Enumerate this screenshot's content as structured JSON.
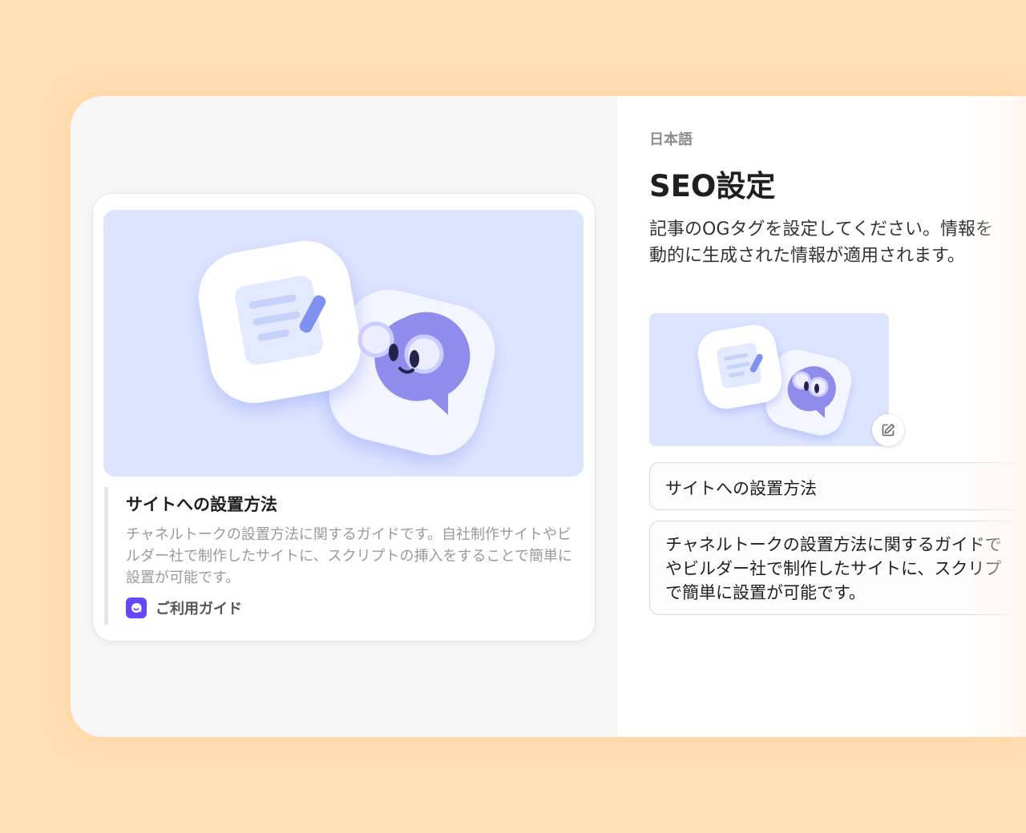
{
  "preview_card": {
    "title": "サイトへの設置方法",
    "description": "チャネルトークの設置方法に関するガイドです。自社制作サイトやビルダー社で制作したサイトに、スクリプトの挿入をすることで簡単に設置が可能です。",
    "source_label": "ご利用ガイド",
    "source_icon": "channel-talk-logo-icon",
    "image": "document-and-mascot-illustration"
  },
  "seo_panel": {
    "language": "日本語",
    "title": "SEO設定",
    "description_line1": "記事のOGタグを設定してください。情報を",
    "description_line2": "動的に生成された情報が適用されます。",
    "og_image": "document-and-mascot-illustration",
    "edit_icon": "edit-pencil-icon",
    "og_title_value": "サイトへの設置方法",
    "og_description_line1": "チャネルトークの設置方法に関するガイドで",
    "og_description_line2": "やビルダー社で制作したサイトに、スクリプ",
    "og_description_line3": "で簡単に設置が可能です。"
  },
  "colors": {
    "background": "#ffe0b8",
    "accent": "#6449fc",
    "illustration_bg": "#dde5fe"
  }
}
